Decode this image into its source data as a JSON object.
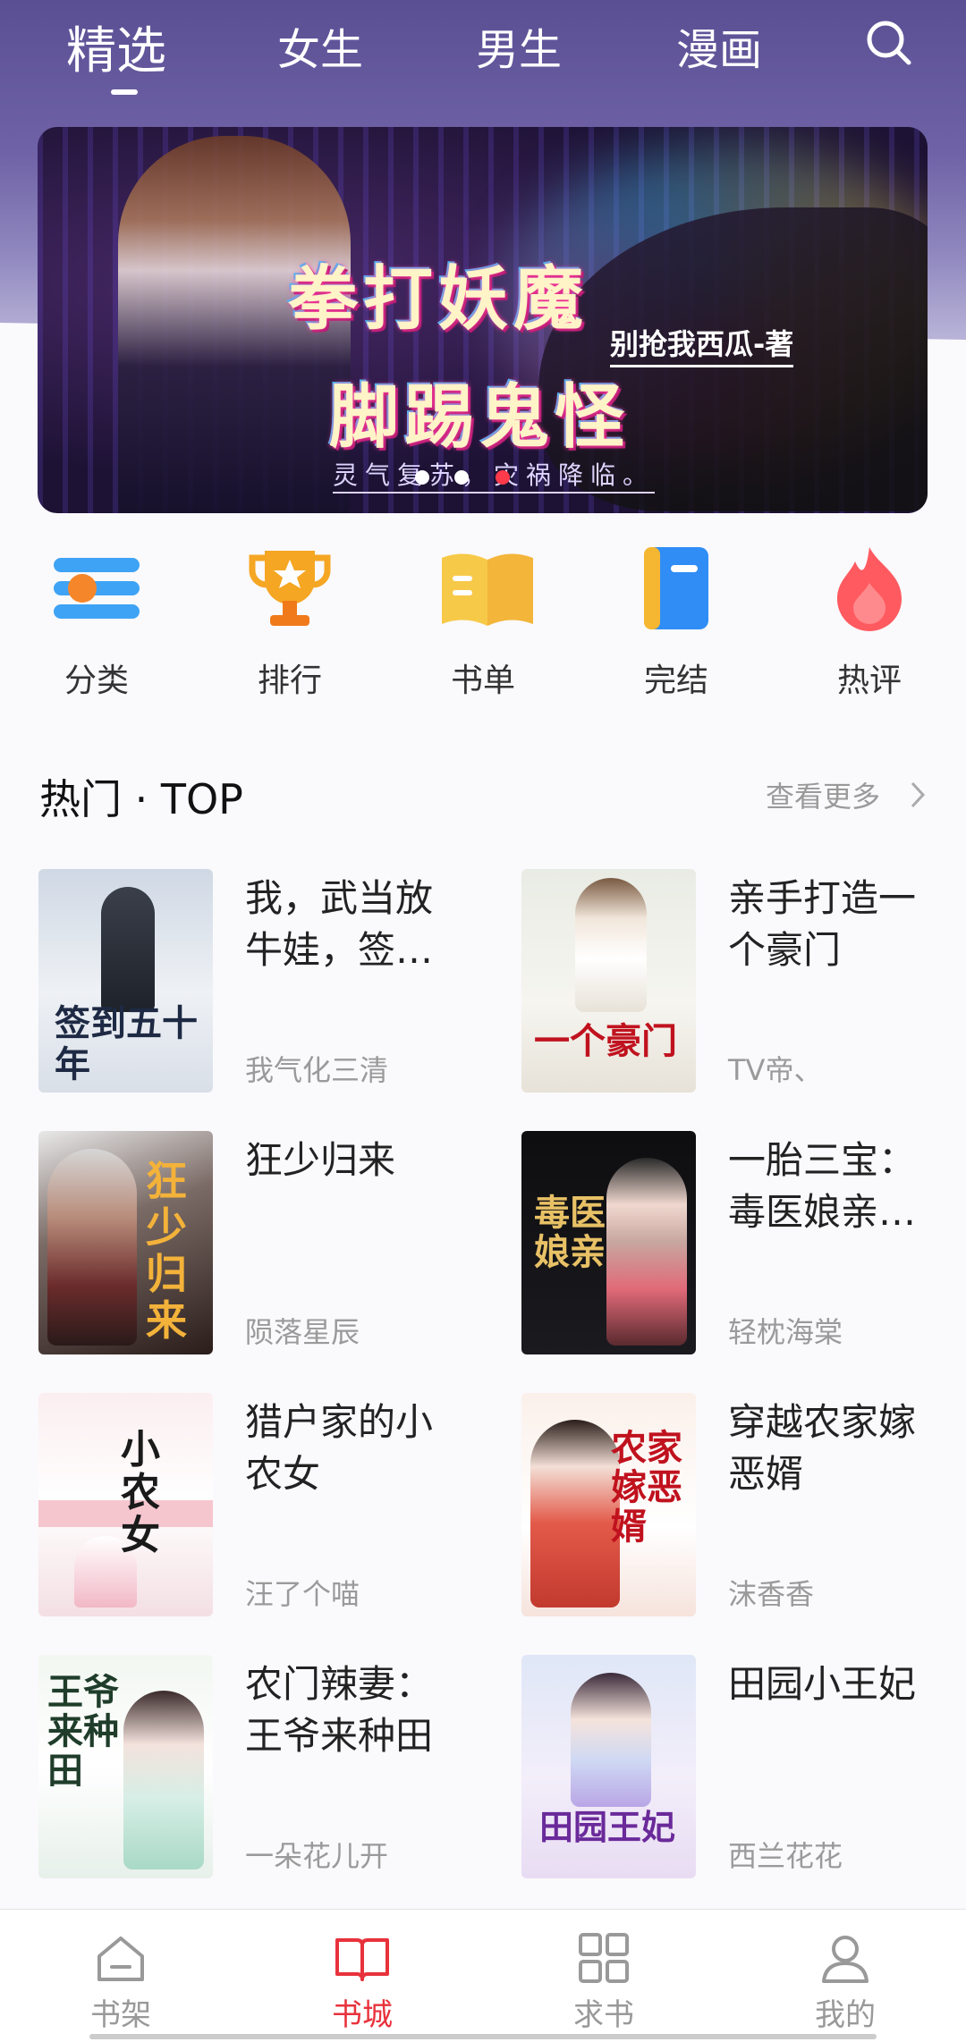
{
  "top_tabs": [
    {
      "label": "精选",
      "active": true
    },
    {
      "label": "女生",
      "active": false
    },
    {
      "label": "男生",
      "active": false
    },
    {
      "label": "漫画",
      "active": false
    }
  ],
  "search": {
    "icon": "search-icon"
  },
  "banner": {
    "title_line1": "拳打妖魔",
    "title_line2": "脚踢鬼怪",
    "author": "别抢我西瓜-著",
    "tagline": "灵气复苏，灾祸降临。",
    "slide_count": 3,
    "active_slide": 3
  },
  "quick_nav": [
    {
      "label": "分类",
      "icon": "category-icon",
      "color": "#3ea3f5"
    },
    {
      "label": "排行",
      "icon": "trophy-icon",
      "color": "#f5a623"
    },
    {
      "label": "书单",
      "icon": "book-list-icon",
      "color": "#f7c948"
    },
    {
      "label": "完结",
      "icon": "completed-book-icon",
      "color": "#2f8df5"
    },
    {
      "label": "热评",
      "icon": "fire-icon",
      "color": "#ff5a5f"
    }
  ],
  "section": {
    "title": "热门 · TOP",
    "more": "查看更多"
  },
  "books": [
    {
      "title": "我，武当放牛娃，签到五十年",
      "author": "我气化三清",
      "cover_text": "签到五十年"
    },
    {
      "title": "亲手打造一个豪门",
      "author": "TV帝、",
      "cover_text": "一个豪门"
    },
    {
      "title": "狂少归来",
      "author": "陨落星辰",
      "cover_text": "狂少归来"
    },
    {
      "title": "一胎三宝：毒医娘亲不好惹",
      "author": "轻枕海棠",
      "cover_text": "毒医娘亲"
    },
    {
      "title": "猎户家的小农女",
      "author": "汪了个喵",
      "cover_text": "小农女"
    },
    {
      "title": "穿越农家嫁恶婿",
      "author": "沫香香",
      "cover_text": "农家嫁恶婿"
    },
    {
      "title": "农门辣妻：王爷来种田",
      "author": "一朵花儿开",
      "cover_text": "王爷来种田"
    },
    {
      "title": "田园小王妃",
      "author": "西兰花花",
      "cover_text": "田园王妃"
    }
  ],
  "bottom_nav": [
    {
      "label": "书架",
      "icon": "bookshelf-home-icon",
      "active": false
    },
    {
      "label": "书城",
      "icon": "open-book-icon",
      "active": true
    },
    {
      "label": "求书",
      "icon": "grid-icon",
      "active": false
    },
    {
      "label": "我的",
      "icon": "user-icon",
      "active": false
    }
  ],
  "colors": {
    "accent": "#e8323c",
    "header": "#5b4f94"
  }
}
